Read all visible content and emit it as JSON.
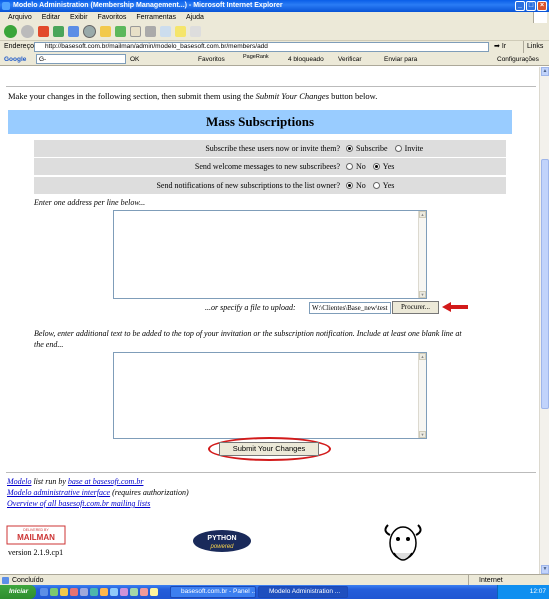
{
  "window": {
    "title": "Modelo Administration (Membership Management...) - Microsoft Internet Explorer",
    "controls": [
      "_",
      "□",
      "×"
    ]
  },
  "menu": [
    "Arquivo",
    "Editar",
    "Exibir",
    "Favoritos",
    "Ferramentas",
    "Ajuda"
  ],
  "address": {
    "label": "Endereço",
    "url": "http://basesoft.com.br/mailman/admin/modelo_basesoft.com.br/members/add",
    "go": "Ir",
    "links": "Links"
  },
  "google_toolbar": {
    "label": "Google",
    "search_prefix": "G-",
    "ok": "OK",
    "favorites": "Favoritos",
    "pagerank": "PageRank",
    "blocked": "4 bloqueado",
    "check": "Verificar",
    "send": "Enviar para",
    "settings": "Configurações"
  },
  "page": {
    "intro_before": "Make your changes in the following section, then submit them using the ",
    "intro_em": "Submit Your Changes",
    "intro_after": " button below.",
    "section_title": "Mass Subscriptions",
    "options": [
      {
        "question": "Subscribe these users now or invite them?",
        "choices": [
          "Subscribe",
          "Invite"
        ],
        "selected": "Subscribe"
      },
      {
        "question": "Send welcome messages to new subscribees?",
        "choices": [
          "No",
          "Yes"
        ],
        "selected": "Yes"
      },
      {
        "question": "Send notifications of new subscriptions to the list owner?",
        "choices": [
          "No",
          "Yes"
        ],
        "selected": "No"
      }
    ],
    "address_label": "Enter one address per line below...",
    "file_label": "...or specify a file to upload:",
    "file_value": "W:\\Clientes\\Base_new\\test",
    "browse": "Procurer...",
    "invite_text_label_1": "Below, enter additional text to be added to the top of your invitation or the subscription notification. Include at least one blank line at",
    "invite_text_label_2": "the end...",
    "submit": "Submit Your Changes"
  },
  "footer": {
    "line1_link": "Modelo",
    "line1_mid": " list run by ",
    "line1_link2": "base at basesoft.com.br",
    "line2_link": "Modelo administrative interface",
    "line2_rest": " (requires authorization)",
    "line3_link": "Overview of all basesoft.com.br mailing lists",
    "mailman_logo": "MAILMAN",
    "mailman_small": "DELIVERED BY",
    "python_logo_1": "PYTHON",
    "python_logo_2": "powered",
    "version": "version 2.1.9.cp1"
  },
  "status": {
    "text": "Concluído",
    "zone": "Internet"
  },
  "taskbar": {
    "start": "Iniciar",
    "tasks": [
      "basesoft.com.br - Panel ...",
      "Modelo Administration ..."
    ],
    "clock": "12:07"
  }
}
